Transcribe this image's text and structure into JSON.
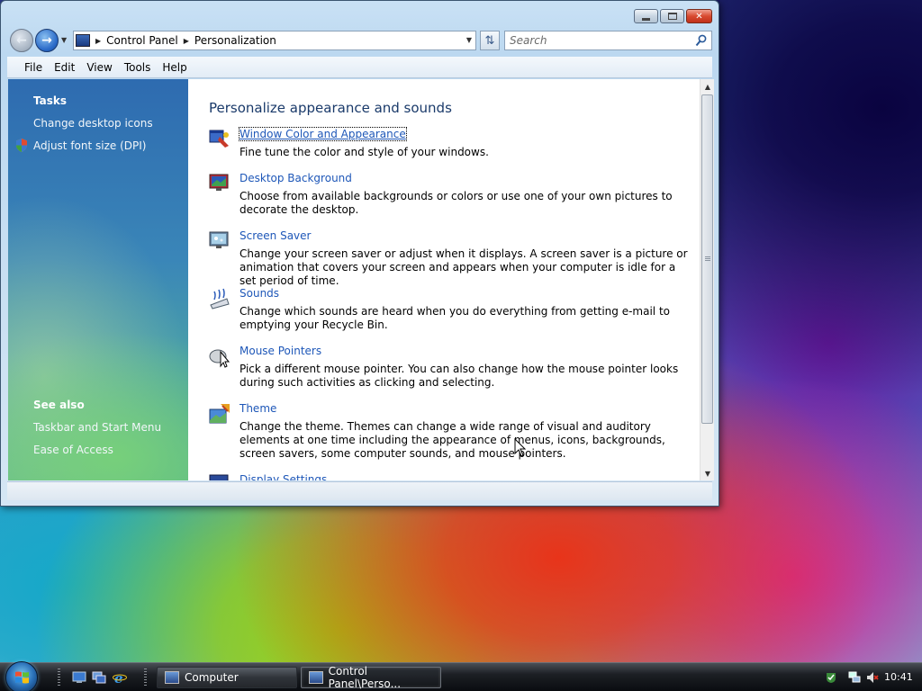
{
  "window": {
    "breadcrumbs": [
      "Control Panel",
      "Personalization"
    ],
    "search_placeholder": "Search",
    "menu": [
      "File",
      "Edit",
      "View",
      "Tools",
      "Help"
    ]
  },
  "sidebar": {
    "tasks_heading": "Tasks",
    "tasks": [
      "Change desktop icons",
      "Adjust font size (DPI)"
    ],
    "see_also_heading": "See also",
    "see_also": [
      "Taskbar and Start Menu",
      "Ease of Access"
    ]
  },
  "content": {
    "title": "Personalize appearance and sounds",
    "items": [
      {
        "icon": "window-color-icon",
        "label": "Window Color and Appearance",
        "desc": "Fine tune the color and style of your windows."
      },
      {
        "icon": "desktop-background-icon",
        "label": "Desktop Background",
        "desc": "Choose from available backgrounds or colors or use one of your own pictures to decorate the desktop."
      },
      {
        "icon": "screen-saver-icon",
        "label": "Screen Saver",
        "desc": "Change your screen saver or adjust when it displays. A screen saver is a picture or animation that covers your screen and appears when your computer is idle for a set period of time."
      },
      {
        "icon": "sounds-icon",
        "label": "Sounds",
        "desc": "Change which sounds are heard when you do everything from getting e-mail to emptying your Recycle Bin."
      },
      {
        "icon": "mouse-pointers-icon",
        "label": "Mouse Pointers",
        "desc": "Pick a different mouse pointer. You can also change how the mouse pointer looks during such activities as clicking and selecting."
      },
      {
        "icon": "theme-icon",
        "label": "Theme",
        "desc": "Change the theme. Themes can change a wide range of visual and auditory elements at one time including the appearance of menus, icons, backgrounds, screen savers, some computer sounds, and mouse pointers."
      },
      {
        "icon": "display-settings-icon",
        "label": "Display Settings",
        "desc": ""
      }
    ]
  },
  "taskbar": {
    "buttons": [
      "Computer",
      "Control Panel\\Perso..."
    ],
    "clock": "10:41"
  },
  "colors": {
    "link": "#1e57b8",
    "heading": "#1a3a6a"
  }
}
